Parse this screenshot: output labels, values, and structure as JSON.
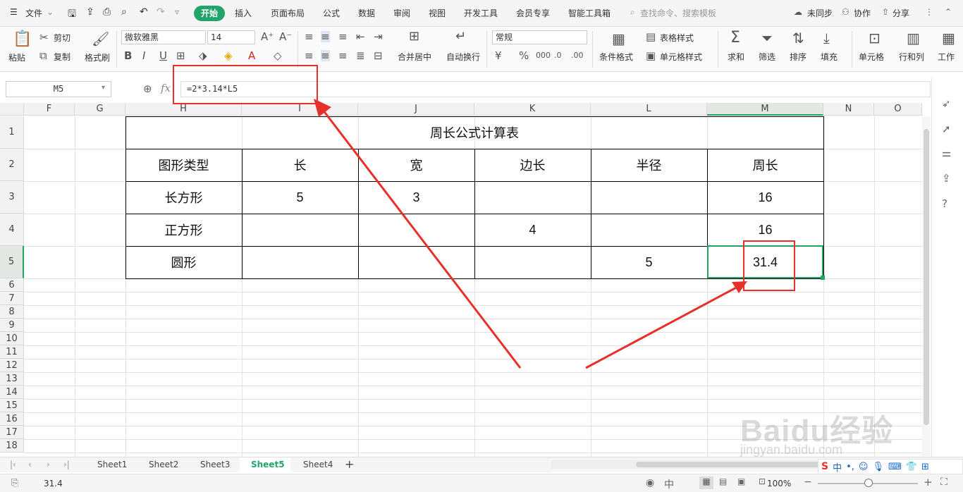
{
  "menu": {
    "file": "文件",
    "tabs": [
      "开始",
      "插入",
      "页面布局",
      "公式",
      "数据",
      "审阅",
      "视图",
      "开发工具",
      "会员专享",
      "智能工具箱"
    ],
    "search_placeholder": "查找命令、搜索模板",
    "sync": "未同步",
    "collab": "协作",
    "share": "分享"
  },
  "ribbon": {
    "paste": "粘贴",
    "cut": "剪切",
    "copy": "复制",
    "format_painter": "格式刷",
    "font_name": "微软雅黑",
    "font_size": "14",
    "merge": "合并居中",
    "wrap": "自动换行",
    "number_format": "常规",
    "conditional_format": "条件格式",
    "table_style": "表格样式",
    "cell_style": "单元格样式",
    "sum": "求和",
    "filter": "筛选",
    "sort": "排序",
    "fill": "填充",
    "cell": "单元格",
    "row_col": "行和列",
    "worksheet": "工作"
  },
  "formula_bar": {
    "name_box": "M5",
    "fx": "fx",
    "formula": "=2*3.14*L5"
  },
  "columns": [
    "F",
    "G",
    "H",
    "I",
    "J",
    "K",
    "L",
    "M",
    "N",
    "O"
  ],
  "rows": [
    "1",
    "2",
    "3",
    "4",
    "5",
    "6",
    "7",
    "8",
    "9",
    "10",
    "11",
    "12",
    "13",
    "14",
    "15",
    "16",
    "17",
    "18"
  ],
  "table": {
    "title": "周长公式计算表",
    "headers": [
      "图形类型",
      "长",
      "宽",
      "边长",
      "半径",
      "周长"
    ],
    "r3": [
      "长方形",
      "5",
      "3",
      "",
      "",
      "16"
    ],
    "r4": [
      "正方形",
      "",
      "",
      "4",
      "",
      "16"
    ],
    "r5": [
      "圆形",
      "",
      "",
      "",
      "5",
      "31.4"
    ]
  },
  "sheets": [
    "Sheet1",
    "Sheet2",
    "Sheet3",
    "Sheet5",
    "Sheet4"
  ],
  "active_sheet": "Sheet5",
  "status": {
    "value": "31.4",
    "zoom": "100%"
  },
  "watermark": {
    "brand": "Baidu经验",
    "url": "jingyan.baidu.com"
  },
  "colors": {
    "accent": "#21a36a",
    "selection": "#1fa464",
    "annotation": "#e8302a"
  }
}
